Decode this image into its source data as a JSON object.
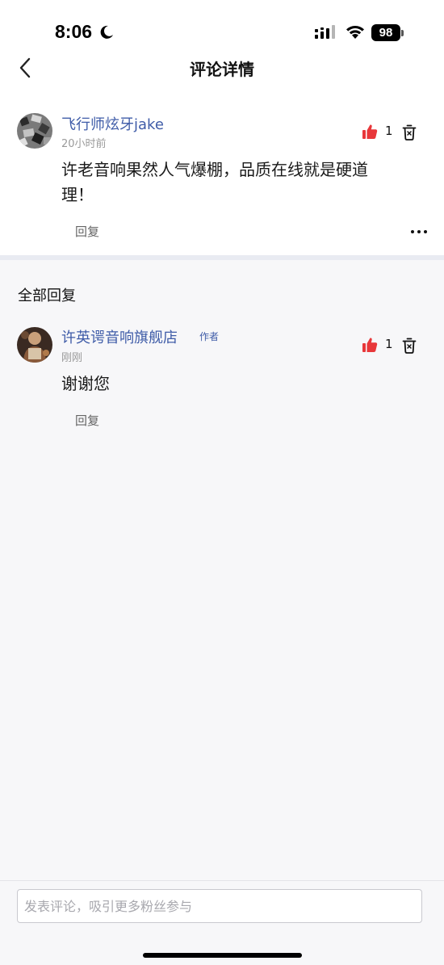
{
  "status": {
    "time": "8:06",
    "battery": "98"
  },
  "nav": {
    "title": "评论详情"
  },
  "comment": {
    "username": "飞行师炫牙jake",
    "timestamp": "20小时前",
    "text_line1": "许老音响果然人气爆棚，品质在线就是硬道",
    "text_line2": "理！",
    "likes": "1",
    "reply_label": "回复"
  },
  "replies": {
    "header": "全部回复",
    "items": [
      {
        "username": "许英谔音响旗舰店",
        "badge": "作者",
        "timestamp": "刚刚",
        "text": "谢谢您",
        "likes": "1",
        "reply_label": "回复"
      }
    ]
  },
  "input": {
    "placeholder": "发表评论，吸引更多粉丝参与"
  },
  "colors": {
    "accent_blue": "#3f5ca8",
    "like_red": "#e8373a",
    "divider": "#e9ebf2"
  }
}
